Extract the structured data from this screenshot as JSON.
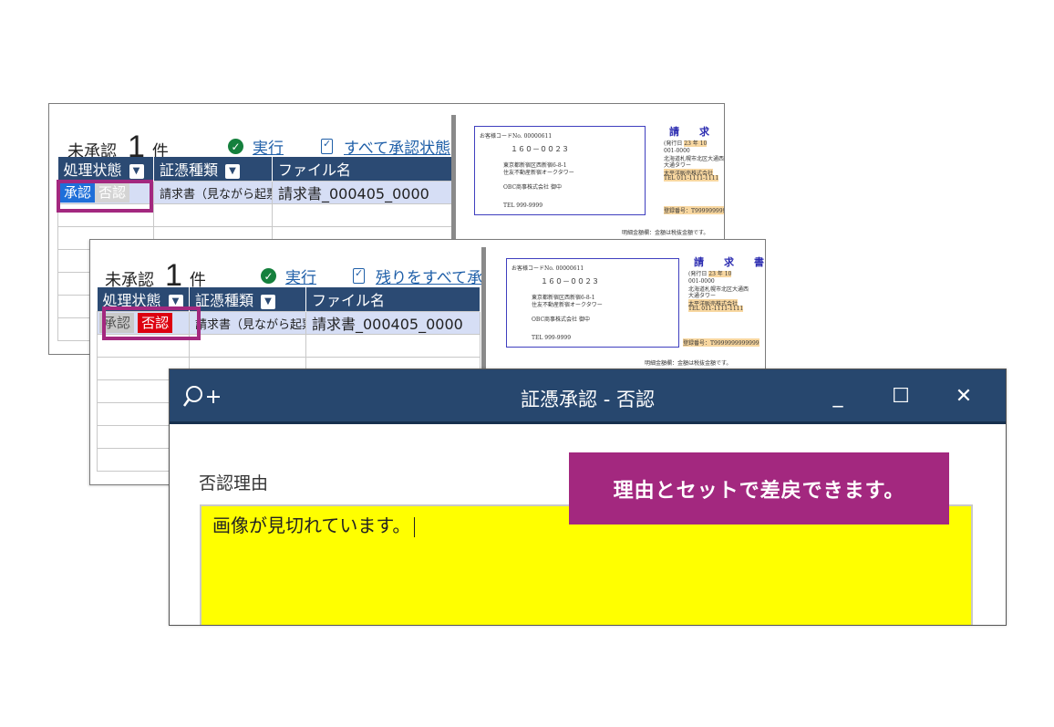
{
  "back_panel": {
    "pending_label": "未承認",
    "pending_count": "1",
    "count_unit": "件",
    "execute_label": "実行",
    "approve_all_label": "すべて承認状態",
    "columns": [
      "処理状態",
      "証憑種類",
      "ファイル名"
    ],
    "row": {
      "approve_label": "承認",
      "reject_label": "否認",
      "doc_type": "請求書（見ながら起票）",
      "file_name": "請求書_000405_0000"
    }
  },
  "front_panel": {
    "pending_label": "未承認",
    "pending_count": "1",
    "count_unit": "件",
    "execute_label": "実行",
    "approve_remaining_label": "残りをすべて承",
    "columns": [
      "処理状態",
      "証憑種類",
      "ファイル名"
    ],
    "row": {
      "approve_label": "承認",
      "reject_label": "否認",
      "doc_type": "請求書（見ながら起票）",
      "file_name": "請求書_000405_0000"
    }
  },
  "invoice": {
    "customer_code_label": "お客様コードNo.",
    "customer_code": "00000611",
    "postal": "１６０－００２３",
    "address1": "東京都新宿区西新宿6-8-1",
    "address2": "住友不動産新宿オークタワー",
    "company": "OBC商事株式会社 御中",
    "tel": "TEL 999-9999",
    "title": "請求書",
    "issue_label": "(発行日",
    "issue_value": "23 年 10",
    "sender_postal": "001-0000",
    "sender_addr1": "北海道札幌市北区大通西",
    "sender_addr2": "大通タワー",
    "sender_company": "太平洋販売株式会社",
    "sender_tel": "TEL 011-1111-1111",
    "registration": "登録番号：T9999999999999",
    "note": "明細金額欄：金額は税抜金額です。"
  },
  "dialog": {
    "title": "証憑承認 - 否認",
    "minimize": "_",
    "maximize": "☐",
    "close": "✕",
    "reason_label": "否認理由",
    "reason_value": "画像が見切れています。"
  },
  "callout": {
    "text": "理由とセットで差戻できます。"
  },
  "colors": {
    "header_bg": "#2b4a73",
    "titlebar_bg": "#27476e",
    "accent_purple": "#a3287f",
    "reason_bg": "#ffff00",
    "reject_red": "#dd0010",
    "approve_blue": "#1e6fd9"
  }
}
